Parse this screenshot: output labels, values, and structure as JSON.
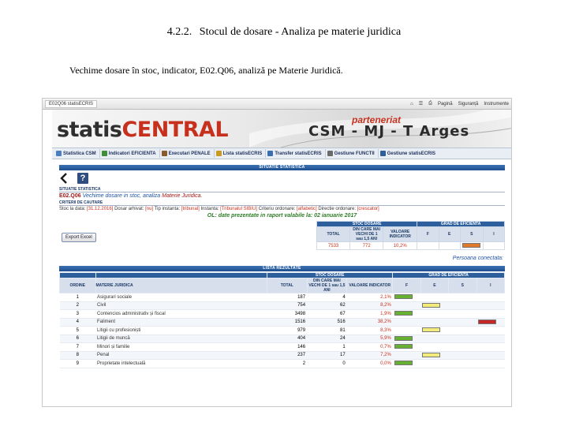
{
  "document": {
    "heading_number": "4.2.2.",
    "heading_title": "Stocul de dosare - Analiza pe materie juridica",
    "caption": "Vechime dosare în stoc, indicator, E02.Q06, analiză pe Materie Juridică."
  },
  "browser": {
    "tab_title": "E02Q06 statisECRIS",
    "tools": [
      "Pagină",
      "Siguranță",
      "Instrumente"
    ]
  },
  "banner": {
    "logo_part1": "statis",
    "logo_part2": "CENTRAL",
    "partner_title": "parteneriat",
    "partner_name": "CSM - MJ - T Arges"
  },
  "menu": {
    "items": [
      {
        "label": "Statistica CSM",
        "icon": "chart-icon",
        "color": "#4a7fc1"
      },
      {
        "label": "Indicatori EFICIENTA",
        "icon": "gauge-icon",
        "color": "#3f8f3a"
      },
      {
        "label": "Executari PENALE",
        "icon": "gavel-icon",
        "color": "#8a5a2b"
      },
      {
        "label": "Lista statisECRIS",
        "icon": "list-icon",
        "color": "#c89a22"
      },
      {
        "label": "Transfer statisECRIS",
        "icon": "transfer-icon",
        "color": "#3b6fb0"
      },
      {
        "label": "Gestiune FUNCTII",
        "icon": "functions-icon",
        "color": "#6b6b6b"
      },
      {
        "label": "Gestiune statisECRIS",
        "icon": "settings-icon",
        "color": "#2f5f99"
      }
    ]
  },
  "situatie": {
    "section_title": "SITUATIE STATISTICA",
    "label": "SITUATIE STATISTICA",
    "code": "E02.Q06",
    "desc1": "Vechime dosare",
    "desc2": "in stoc, analiza",
    "desc3": "Materie Juridica.",
    "criteria_label": "CRITERII DE CAUTARE",
    "criteria_line": {
      "t1": "Stoc la data: ",
      "v1": "[31.12.2016]",
      "t2": " Dosar arhivat: ",
      "v2": "[nu]",
      "t3": " Tip instanta: ",
      "v3": "[tribunal]",
      "t4": " Instanta: ",
      "v4": "[Tribunalul SIBIU]",
      "t5": " Criteriu ordonare: ",
      "v5": "[alfabetic]",
      "t6": " Directie ordonare: ",
      "v6": "[crescator]"
    },
    "note": "OL: date prezentate in raport valabile la: 02 ianuarie 2017"
  },
  "export_button": "Export Excel",
  "stoc_summary": {
    "group_stoc": "STOC DOSARE",
    "group_grad": "GRAD DE EFICIENTA",
    "col_total": "TOTAL",
    "col_ani": "DIN CARE MAI VECHI DE 1 sau 1,5 ANI",
    "col_valoare": "VALOARE INDICATOR",
    "col_f": "F",
    "col_e": "E",
    "col_s": "S",
    "col_i": "I",
    "total": "7533",
    "ani": "772",
    "valoare": "10,2%"
  },
  "persoana": "Persoana conectata:",
  "results": {
    "section_title": "LISTA REZULTATE",
    "group_stoc": "STOC DOSARE",
    "group_grad": "GRAD DE EFICIENTA",
    "col_ordine": "ORDINE",
    "col_materie": "MATERIE JURIDICA",
    "col_total": "TOTAL",
    "col_ani": "DIN CARE MAI VECHI DE 1 sau 1,5 ANI",
    "col_valoare": "VALOARE INDICATOR",
    "col_f": "F",
    "col_e": "E",
    "col_s": "S",
    "col_i": "I",
    "grade_colors": {
      "F": "#66b032",
      "E": "#f3ec7a",
      "S": "#e07a2a",
      "I": "#c62828"
    },
    "rows": [
      {
        "ordine": "1",
        "materie": "Asigurari sociale",
        "total": "187",
        "ani": "4",
        "valoare": "2,1%",
        "grad": "F"
      },
      {
        "ordine": "2",
        "materie": "Civil",
        "total": "754",
        "ani": "62",
        "valoare": "8,2%",
        "grad": "E"
      },
      {
        "ordine": "3",
        "materie": "Contencios administrativ și fiscal",
        "total": "3498",
        "ani": "67",
        "valoare": "1,9%",
        "grad": "F"
      },
      {
        "ordine": "4",
        "materie": "Faliment",
        "total": "1516",
        "ani": "516",
        "valoare": "38,2%",
        "grad": "I"
      },
      {
        "ordine": "5",
        "materie": "Litigii cu profesioniști",
        "total": "979",
        "ani": "81",
        "valoare": "8,3%",
        "grad": "E"
      },
      {
        "ordine": "6",
        "materie": "Litigii de muncă",
        "total": "404",
        "ani": "24",
        "valoare": "5,9%",
        "grad": "F"
      },
      {
        "ordine": "7",
        "materie": "Minori și familie",
        "total": "146",
        "ani": "1",
        "valoare": "0,7%",
        "grad": "F"
      },
      {
        "ordine": "8",
        "materie": "Penal",
        "total": "237",
        "ani": "17",
        "valoare": "7,2%",
        "grad": "E"
      },
      {
        "ordine": "9",
        "materie": "Proprietate intelectuală",
        "total": "2",
        "ani": "0",
        "valoare": "0,0%",
        "grad": "F"
      }
    ]
  }
}
